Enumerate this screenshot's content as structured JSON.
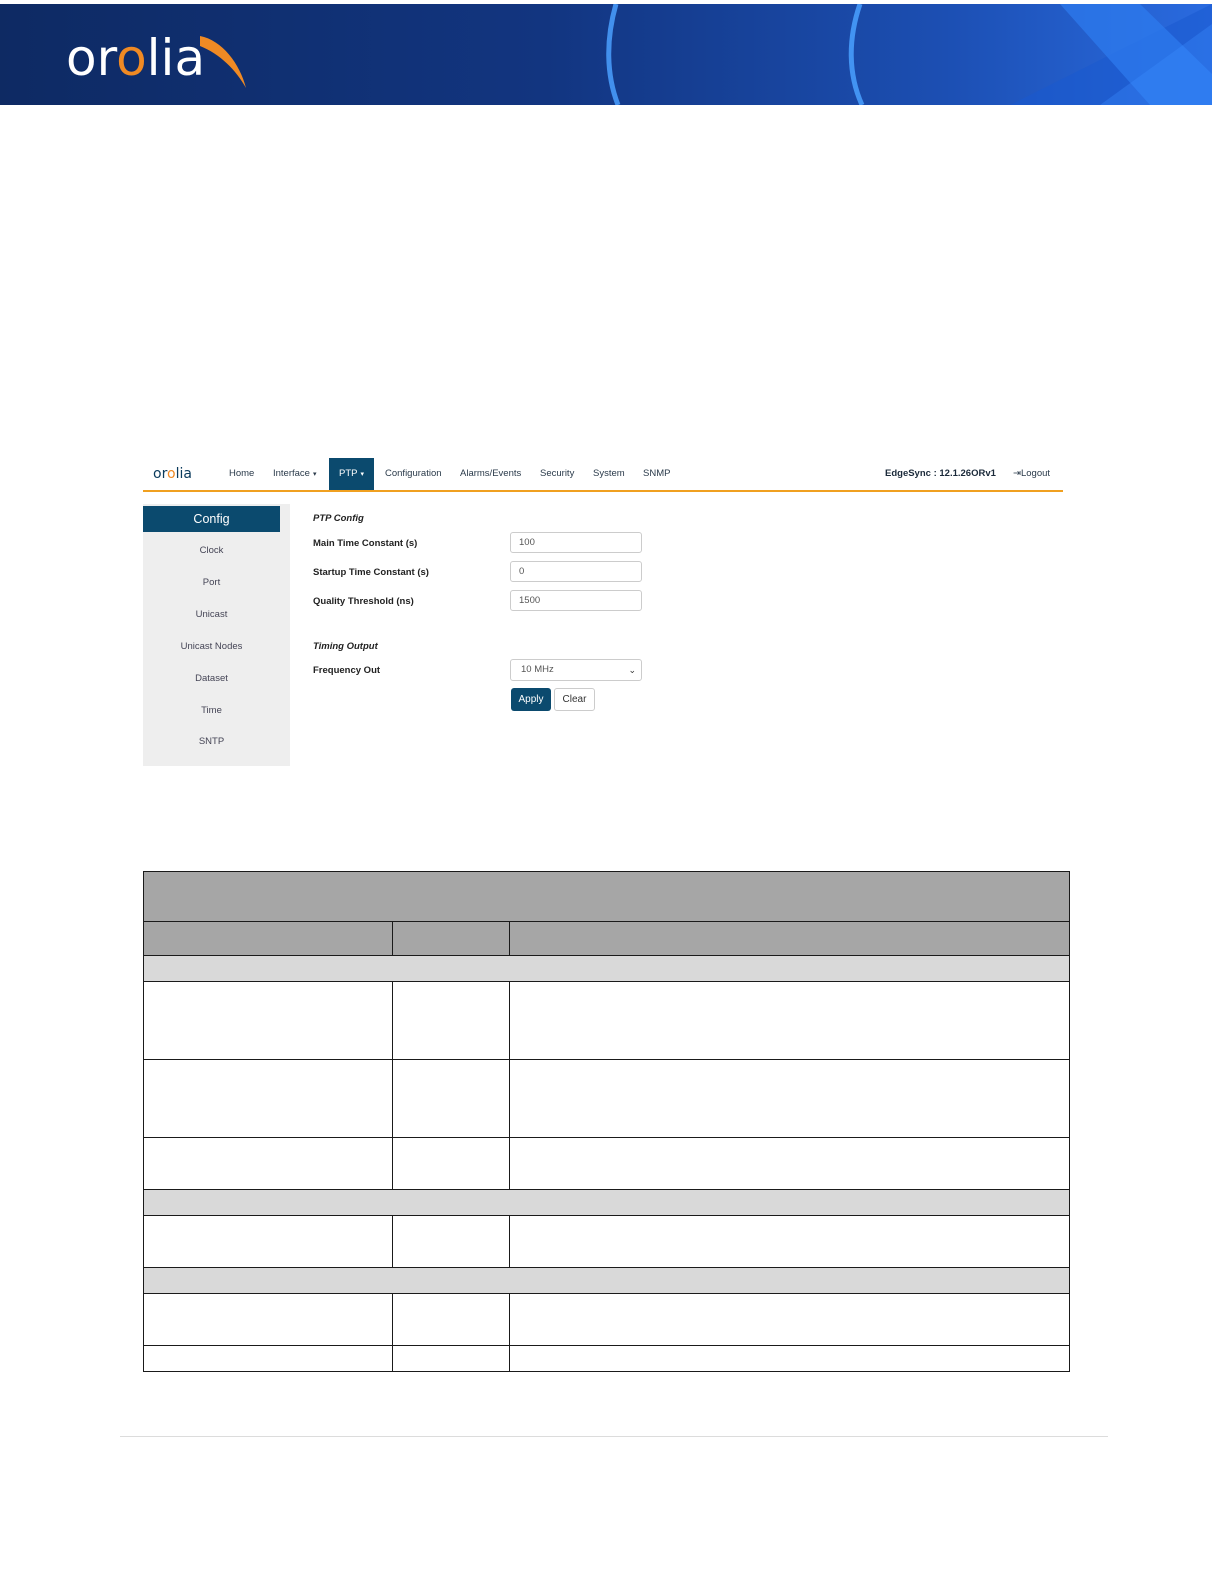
{
  "banner": {
    "logo_prefix": "or",
    "logo_accent": "o",
    "logo_suffix": "lia"
  },
  "screenshot": {
    "logo_prefix": "or",
    "logo_accent": "o",
    "logo_suffix": "lia",
    "nav": [
      {
        "label": "Home"
      },
      {
        "label": "Interface",
        "caret": "▾"
      },
      {
        "label": "PTP",
        "caret": "▾"
      },
      {
        "label": "Configuration"
      },
      {
        "label": "Alarms/Events"
      },
      {
        "label": "Security"
      },
      {
        "label": "System"
      },
      {
        "label": "SNMP"
      }
    ],
    "version": "EdgeSync : 12.1.26ORv1",
    "logout_icon": "⇥",
    "logout_label": "Logout",
    "sidebar": {
      "title": "Config",
      "items": [
        "Clock",
        "Port",
        "Unicast",
        "Unicast Nodes",
        "Dataset",
        "Time",
        "SNTP"
      ]
    },
    "form": {
      "section1": "PTP Config",
      "main_tc_label": "Main Time Constant (s)",
      "main_tc_value": "100",
      "startup_tc_label": "Startup Time Constant (s)",
      "startup_tc_value": "0",
      "quality_label": "Quality Threshold (ns)",
      "quality_value": "1500",
      "section2": "Timing Output",
      "freq_label": "Frequency Out",
      "freq_value": "10 MHz",
      "apply_label": "Apply",
      "clear_label": "Clear"
    }
  },
  "colors": {
    "banner_blue": "#123580",
    "nav_active": "#0b4a6e",
    "nav_underline": "#f0a020",
    "logo_orange": "#f08a24",
    "table_header": "#a6a6a6",
    "table_group": "#d9d9d9"
  }
}
